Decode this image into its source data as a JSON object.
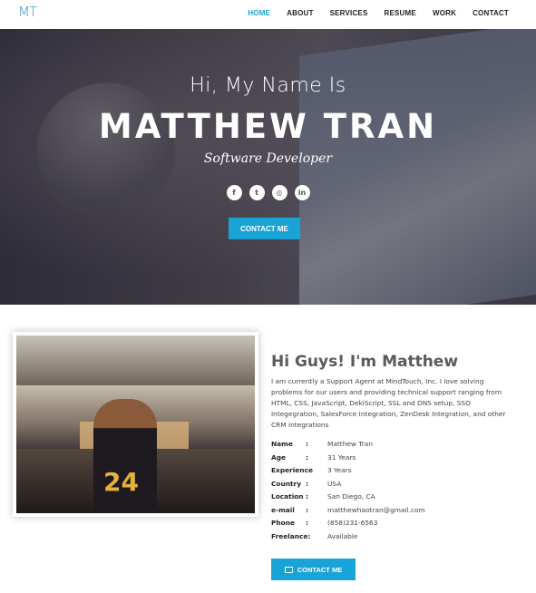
{
  "nav": {
    "logo": "MT",
    "items": [
      {
        "label": "HOME"
      },
      {
        "label": "ABOUT"
      },
      {
        "label": "SERVICES"
      },
      {
        "label": "RESUME"
      },
      {
        "label": "WORK"
      },
      {
        "label": "CONTACT"
      }
    ],
    "active_color": "#1aa3d6"
  },
  "hero": {
    "greeting": "Hi, My Name Is",
    "name": "MATTHEW TRAN",
    "role": "Software Developer",
    "socials": [
      {
        "icon": "facebook-icon",
        "glyph": "f"
      },
      {
        "icon": "twitter-icon",
        "glyph": "t"
      },
      {
        "icon": "instagram-icon",
        "glyph": "◎"
      },
      {
        "icon": "linkedin-icon",
        "glyph": "in"
      }
    ],
    "button_label": "CONTACT ME"
  },
  "about": {
    "title": "Hi Guys! I'm Matthew",
    "bio": "I am currently a Support Agent at MindTouch, Inc. I love solving problems for our users and providing technical support ranging from HTML, CSS, JavaScript, DekiScript, SSL and DNS setup, SSO Integegration, SalesForce Integration, ZenDesk Integration, and other CRM integrations",
    "info": [
      {
        "key": "Name",
        "sep": ":",
        "value": "Matthew Tran"
      },
      {
        "key": "Age",
        "sep": ":",
        "value": "31 Years"
      },
      {
        "key": "Experience",
        "sep": "",
        "value": "3 Years"
      },
      {
        "key": "Country",
        "sep": ":",
        "value": "USA"
      },
      {
        "key": "Location",
        "sep": ":",
        "value": "San Diego, CA"
      },
      {
        "key": "e-mail",
        "sep": ":",
        "value": "matthewhaotran@gmail.com"
      },
      {
        "key": "Phone",
        "sep": ":",
        "value": "(858)231-6563"
      },
      {
        "key": "Freelance:",
        "sep": "",
        "value": "Available"
      }
    ],
    "photo_jersey": "24",
    "button_label": "CONTACT ME"
  },
  "colors": {
    "accent": "#1aa3d6",
    "logo": "#2e8fc9"
  }
}
